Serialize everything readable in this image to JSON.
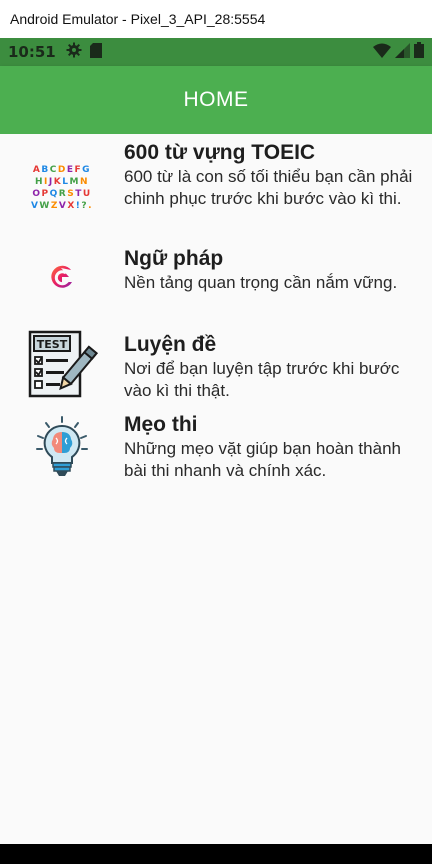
{
  "window": {
    "title": "Android Emulator - Pixel_3_API_28:5554"
  },
  "status_bar": {
    "time": "10:51",
    "icons": [
      "gear-icon",
      "sd-card-icon",
      "wifi-icon",
      "signal-icon",
      "battery-icon"
    ]
  },
  "app_bar": {
    "title": "HOME",
    "color": "#4caf50"
  },
  "items": [
    {
      "title": "600 từ vựng TOEIC",
      "description": "600 từ là con số tối thiểu bạn cần phải chinh phục trước khi bước vào kì thi.",
      "icon": "alphabet-icon"
    },
    {
      "title": "Ngữ pháp",
      "description": "Nền tảng quan trọng cần nắm vững.",
      "icon": "grammar-logo-icon"
    },
    {
      "title": "Luyện đề",
      "description": "Nơi để bạn luyện tập trước khi bước vào kì thi thật.",
      "icon": "test-paper-icon"
    },
    {
      "title": "Mẹo thi",
      "description": "Những mẹo vặt giúp bạn hoàn thành bài thi nhanh và chính xác.",
      "icon": "lightbulb-brain-icon"
    }
  ],
  "test_icon_label": "TEST",
  "alphabet_rows": [
    "ABCDEFG",
    "HIJKLMN",
    "OPQRSTU",
    "VWXYZ!?."
  ]
}
